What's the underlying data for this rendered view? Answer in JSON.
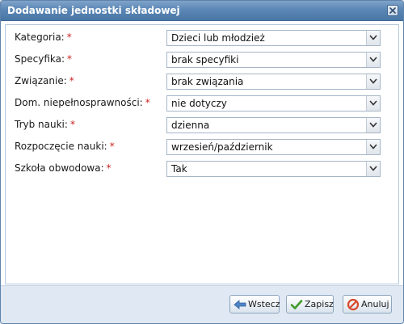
{
  "dialog": {
    "title": "Dodawanie jednostki składowej"
  },
  "form": {
    "fields": [
      {
        "label": "Kategoria:",
        "required_mark": "*",
        "value": "Dzieci lub młodzież"
      },
      {
        "label": "Specyfika:",
        "required_mark": "*",
        "value": "brak specyfiki"
      },
      {
        "label": "Związanie:",
        "required_mark": "*",
        "value": "brak związania"
      },
      {
        "label": "Dom. niepełnosprawności:",
        "required_mark": "*",
        "value": "nie dotyczy"
      },
      {
        "label": "Tryb nauki:",
        "required_mark": "*",
        "value": "dzienna"
      },
      {
        "label": "Rozpoczęcie nauki:",
        "required_mark": "*",
        "value": "wrzesień/październik"
      },
      {
        "label": "Szkoła obwodowa:",
        "required_mark": "*",
        "value": "Tak"
      }
    ]
  },
  "buttons": {
    "back_label": "Wstecz",
    "save_label": "Zapisz",
    "cancel_label": "Anuluj"
  },
  "icons": {
    "close": "close-icon",
    "dropdown": "chevron-down-icon",
    "back": "arrow-left-icon",
    "save": "checkmark-icon",
    "cancel": "cancel-icon"
  },
  "colors": {
    "titlebar": "#5b87b6",
    "required": "#cc2222",
    "footer": "#dfe8f3"
  }
}
